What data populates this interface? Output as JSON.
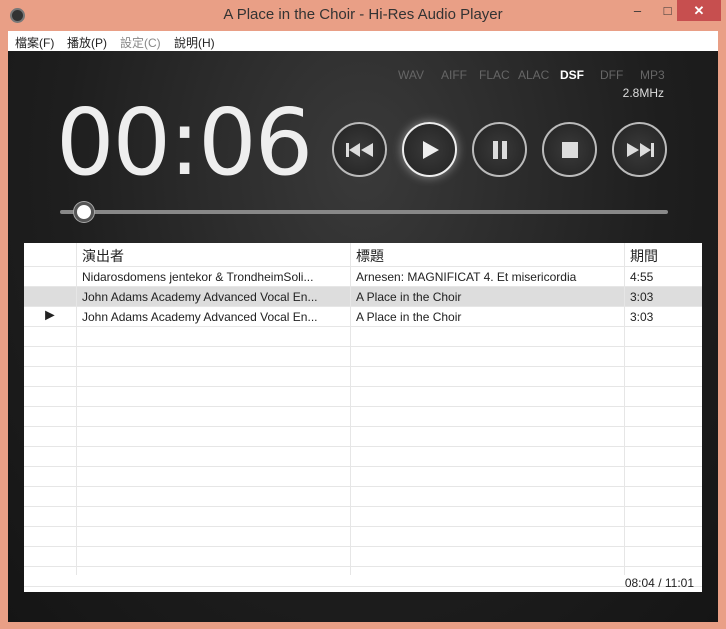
{
  "window": {
    "title": "A Place in the Choir - Hi-Res Audio Player",
    "minimize": "–",
    "maximize": "□",
    "close": "✕"
  },
  "menu": [
    {
      "label": "檔案(F)"
    },
    {
      "label": "播放(P)"
    },
    {
      "label": "設定(C)"
    },
    {
      "label": "說明(H)"
    }
  ],
  "formats": [
    "WAV",
    "AIFF",
    "FLAC",
    "ALAC",
    "DSF",
    "DFF",
    "MP3"
  ],
  "active_format": "DSF",
  "sample_rate": "2.8MHz",
  "elapsed": "00:06",
  "progress_fraction": 0.04,
  "playlist": {
    "headers": [
      "演出者",
      "標題",
      "期間"
    ],
    "rows": [
      {
        "indicator": "",
        "artist": "Nidarosdomens jentekor & TrondheimSoli...",
        "title": "Arnesen: MAGNIFICAT 4. Et misericordia",
        "duration": "4:55"
      },
      {
        "indicator": "",
        "artist": "John Adams Academy Advanced Vocal En...",
        "title": "A Place in the Choir",
        "duration": "3:03"
      },
      {
        "indicator": "►",
        "artist": "John Adams Academy Advanced Vocal En...",
        "title": "A Place in the Choir",
        "duration": "3:03"
      }
    ],
    "total": "08:04 / 11:01"
  }
}
